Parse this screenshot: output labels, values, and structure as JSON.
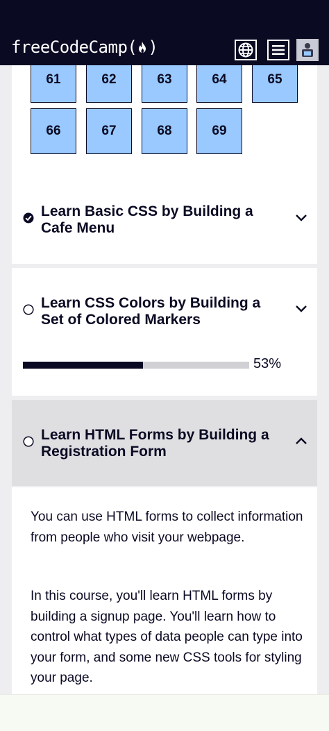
{
  "navbar": {
    "brand_left": "freeCodeCamp(",
    "brand_right": ")",
    "icons": [
      "globe-icon",
      "menu-icon",
      "avatar"
    ]
  },
  "steps": {
    "row1": [
      "61",
      "62",
      "63",
      "64",
      "65"
    ],
    "row2": [
      "66",
      "67",
      "68",
      "69"
    ]
  },
  "blocks": [
    {
      "title": "Learn Basic CSS by Building a Cafe Menu",
      "completed": true,
      "expanded": false
    },
    {
      "title": "Learn CSS Colors by Building a Set of Colored Markers",
      "completed": false,
      "expanded": false,
      "progress": 0.53,
      "progress_label": "53%"
    },
    {
      "title": "Learn HTML Forms by Building a Registration Form",
      "completed": false,
      "expanded": true
    }
  ],
  "description": {
    "p1": "You can use HTML forms to collect information from people who visit your webpage.",
    "p2": "In this course, you'll learn HTML forms by building a signup page. You'll learn how to control what types of data people can type into your form, and some new CSS tools for styling your page."
  },
  "colors": {
    "dark": "#0a0a23",
    "step_bg": "#99c9ff",
    "progress_track": "#d0d0d5",
    "expanded_bg": "#dfdfe2"
  }
}
